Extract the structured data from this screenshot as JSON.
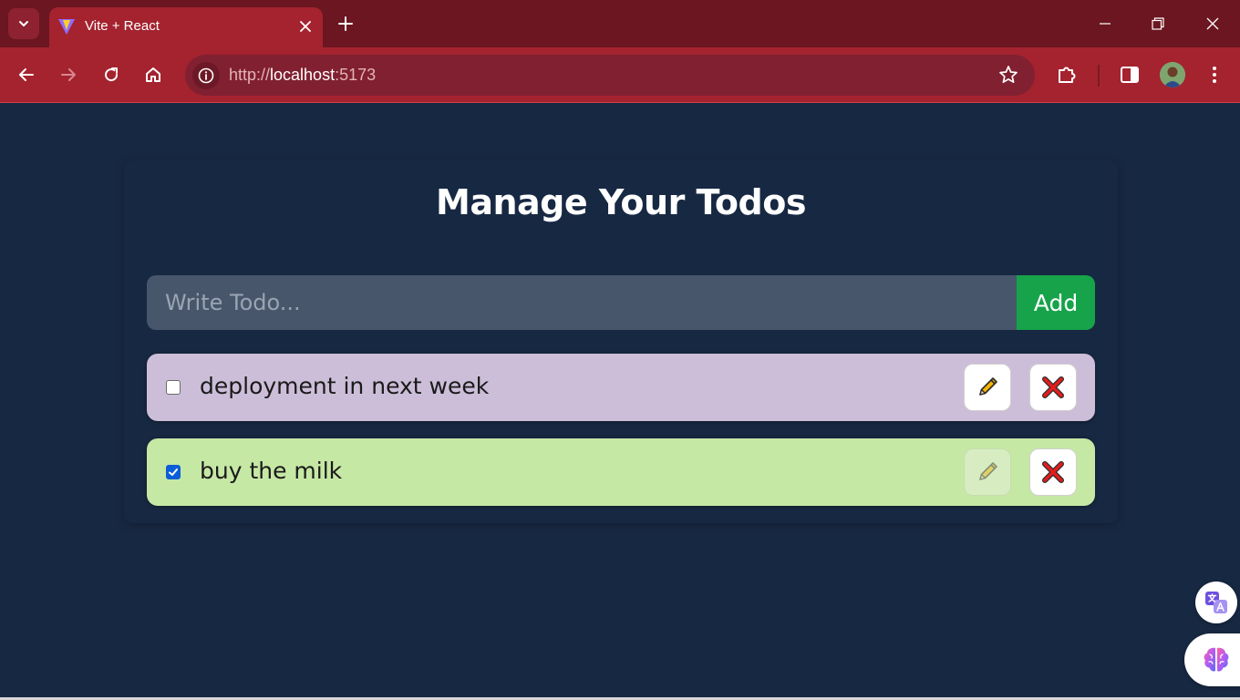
{
  "browser": {
    "tab_title": "Vite + React",
    "url_scheme": "http://",
    "url_host": "localhost",
    "url_port": ":5173"
  },
  "page": {
    "title": "Manage Your Todos",
    "input_placeholder": "Write Todo...",
    "input_value": "",
    "add_label": "Add"
  },
  "todos": [
    {
      "text": "deployment in next week",
      "completed": false,
      "edit_icon": "pencil-icon",
      "delete_icon": "cross-icon"
    },
    {
      "text": "buy the milk",
      "completed": true,
      "edit_icon": "pencil-icon",
      "delete_icon": "cross-icon"
    }
  ],
  "colors": {
    "tab_strip": "#6b1620",
    "toolbar": "#a4232f",
    "page_bg": "#172842",
    "input_bg": "#48566c",
    "add_button": "#16a34a",
    "todo_pending_bg": "#ccbed8",
    "todo_done_bg": "#c6e8a5",
    "delete_x": "#e11d1d"
  },
  "extensions": [
    "translate-icon",
    "brain-icon"
  ]
}
